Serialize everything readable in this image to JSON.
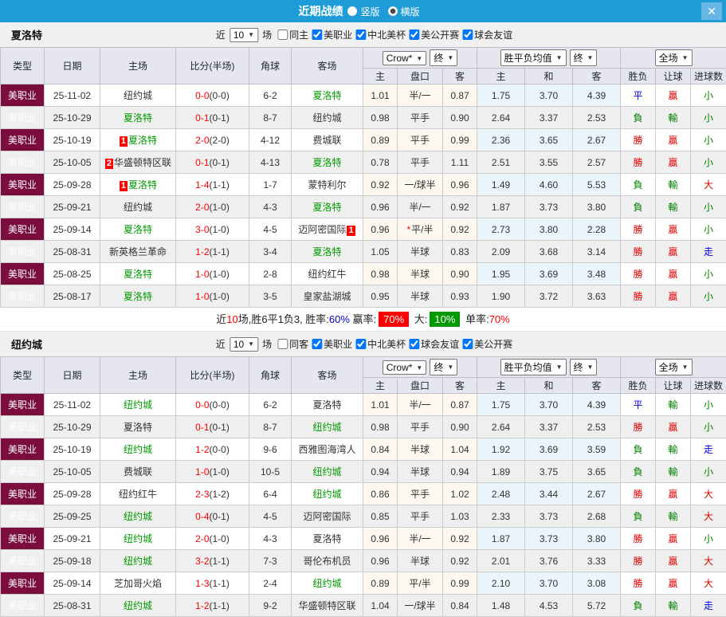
{
  "header": {
    "title": "近期战绩",
    "layout_options": [
      {
        "label": "竖版",
        "selected": false
      },
      {
        "label": "横版",
        "selected": true
      }
    ],
    "close_icon": "✕"
  },
  "columns": {
    "type": "类型",
    "date": "日期",
    "home": "主场",
    "score": "比分(半场)",
    "corner": "角球",
    "away": "客场",
    "odds_select": "Crow*",
    "odds_final": "终",
    "odds_sub": [
      "主",
      "盘口",
      "客"
    ],
    "euro_select": "胜平负均值",
    "euro_final": "终",
    "euro_sub": [
      "主",
      "和",
      "客"
    ],
    "scope_select": "全场",
    "result_sub": [
      "胜负",
      "让球",
      "进球数"
    ]
  },
  "colors": {
    "accent_blue": "#1e9cd8",
    "type_maroon": "#7b0c3e",
    "team_green": "#009000",
    "score_red": "#ff0000",
    "win_red": "#e00000",
    "lose_green": "#008000",
    "draw_blue": "#0000e0"
  },
  "tables": [
    {
      "team": "夏洛特",
      "filter": {
        "near": "近",
        "count": "10",
        "games": "场",
        "same": "同主",
        "same_checked": false,
        "leagues": [
          {
            "label": "美职业",
            "checked": true
          },
          {
            "label": "中北美杯",
            "checked": true
          },
          {
            "label": "美公开赛",
            "checked": true
          },
          {
            "label": "球会友谊",
            "checked": true
          }
        ]
      },
      "rows": [
        {
          "type": "美职业",
          "date": "25-11-02",
          "home": "纽约城",
          "home_badge": "",
          "home_green": false,
          "ft": "0-0",
          "half": "(0-0)",
          "corner": "6-2",
          "away": "夏洛特",
          "away_badge": "",
          "away_green": true,
          "ah": [
            "1.01",
            "半/一",
            "0.87"
          ],
          "ah_star": false,
          "eu": [
            "1.75",
            "3.70",
            "4.39"
          ],
          "res": [
            "平",
            "贏",
            "小"
          ]
        },
        {
          "type": "美职业",
          "date": "25-10-29",
          "home": "夏洛特",
          "home_badge": "",
          "home_green": true,
          "ft": "0-1",
          "half": "(0-1)",
          "corner": "8-7",
          "away": "纽约城",
          "away_badge": "",
          "away_green": false,
          "ah": [
            "0.98",
            "平手",
            "0.90"
          ],
          "ah_star": false,
          "eu": [
            "2.64",
            "3.37",
            "2.53"
          ],
          "res": [
            "負",
            "輸",
            "小"
          ]
        },
        {
          "type": "美职业",
          "date": "25-10-19",
          "home": "夏洛特",
          "home_badge": "1",
          "home_green": true,
          "ft": "2-0",
          "half": "(2-0)",
          "corner": "4-12",
          "away": "费城联",
          "away_badge": "",
          "away_green": false,
          "ah": [
            "0.89",
            "平手",
            "0.99"
          ],
          "ah_star": false,
          "eu": [
            "2.36",
            "3.65",
            "2.67"
          ],
          "res": [
            "勝",
            "贏",
            "小"
          ]
        },
        {
          "type": "美职业",
          "date": "25-10-05",
          "home": "华盛顿特区联",
          "home_badge": "2",
          "home_green": false,
          "ft": "0-1",
          "half": "(0-1)",
          "corner": "4-13",
          "away": "夏洛特",
          "away_badge": "",
          "away_green": true,
          "ah": [
            "0.78",
            "平手",
            "1.11"
          ],
          "ah_star": false,
          "eu": [
            "2.51",
            "3.55",
            "2.57"
          ],
          "res": [
            "勝",
            "贏",
            "小"
          ]
        },
        {
          "type": "美职业",
          "date": "25-09-28",
          "home": "夏洛特",
          "home_badge": "1",
          "home_green": true,
          "ft": "1-4",
          "half": "(1-1)",
          "corner": "1-7",
          "away": "蒙特利尔",
          "away_badge": "",
          "away_green": false,
          "ah": [
            "0.92",
            "一/球半",
            "0.96"
          ],
          "ah_star": false,
          "eu": [
            "1.49",
            "4.60",
            "5.53"
          ],
          "res": [
            "負",
            "輸",
            "大"
          ]
        },
        {
          "type": "美职业",
          "date": "25-09-21",
          "home": "纽约城",
          "home_badge": "",
          "home_green": false,
          "ft": "2-0",
          "half": "(1-0)",
          "corner": "4-3",
          "away": "夏洛特",
          "away_badge": "",
          "away_green": true,
          "ah": [
            "0.96",
            "半/一",
            "0.92"
          ],
          "ah_star": false,
          "eu": [
            "1.87",
            "3.73",
            "3.80"
          ],
          "res": [
            "負",
            "輸",
            "小"
          ]
        },
        {
          "type": "美职业",
          "date": "25-09-14",
          "home": "夏洛特",
          "home_badge": "",
          "home_green": true,
          "ft": "3-0",
          "half": "(1-0)",
          "corner": "4-5",
          "away": "迈阿密国际",
          "away_badge": "1",
          "away_green": false,
          "ah": [
            "0.96",
            "平/半",
            "0.92"
          ],
          "ah_star": true,
          "eu": [
            "2.73",
            "3.80",
            "2.28"
          ],
          "res": [
            "勝",
            "贏",
            "小"
          ]
        },
        {
          "type": "美职业",
          "date": "25-08-31",
          "home": "新英格兰革命",
          "home_badge": "",
          "home_green": false,
          "ft": "1-2",
          "half": "(1-1)",
          "corner": "3-4",
          "away": "夏洛特",
          "away_badge": "",
          "away_green": true,
          "ah": [
            "1.05",
            "半球",
            "0.83"
          ],
          "ah_star": false,
          "eu": [
            "2.09",
            "3.68",
            "3.14"
          ],
          "res": [
            "勝",
            "贏",
            "走"
          ]
        },
        {
          "type": "美职业",
          "date": "25-08-25",
          "home": "夏洛特",
          "home_badge": "",
          "home_green": true,
          "ft": "1-0",
          "half": "(1-0)",
          "corner": "2-8",
          "away": "纽约红牛",
          "away_badge": "",
          "away_green": false,
          "ah": [
            "0.98",
            "半球",
            "0.90"
          ],
          "ah_star": false,
          "eu": [
            "1.95",
            "3.69",
            "3.48"
          ],
          "res": [
            "勝",
            "贏",
            "小"
          ]
        },
        {
          "type": "美职业",
          "date": "25-08-17",
          "home": "夏洛特",
          "home_badge": "",
          "home_green": true,
          "ft": "1-0",
          "half": "(1-0)",
          "corner": "3-5",
          "away": "皇家盐湖城",
          "away_badge": "",
          "away_green": false,
          "ah": [
            "0.95",
            "半球",
            "0.93"
          ],
          "ah_star": false,
          "eu": [
            "1.90",
            "3.72",
            "3.63"
          ],
          "res": [
            "勝",
            "贏",
            "小"
          ]
        }
      ],
      "summary": [
        {
          "text": "近"
        },
        {
          "text": "10",
          "style": "red"
        },
        {
          "text": "场,胜6平1负3, 胜率:"
        },
        {
          "text": "60%",
          "style": "blue"
        },
        {
          "text": " 赢率:"
        },
        {
          "text": "70%",
          "style": "bg-red"
        },
        {
          "text": " 大:"
        },
        {
          "text": "10%",
          "style": "bg-green"
        },
        {
          "text": " 单率:"
        },
        {
          "text": "70%",
          "style": "red"
        }
      ]
    },
    {
      "team": "纽约城",
      "filter": {
        "near": "近",
        "count": "10",
        "games": "场",
        "same": "同客",
        "same_checked": false,
        "leagues": [
          {
            "label": "美职业",
            "checked": true
          },
          {
            "label": "中北美杯",
            "checked": true
          },
          {
            "label": "球会友谊",
            "checked": true
          },
          {
            "label": "美公开赛",
            "checked": true
          }
        ]
      },
      "rows": [
        {
          "type": "美职业",
          "date": "25-11-02",
          "home": "纽约城",
          "home_badge": "",
          "home_green": true,
          "ft": "0-0",
          "half": "(0-0)",
          "corner": "6-2",
          "away": "夏洛特",
          "away_badge": "",
          "away_green": false,
          "ah": [
            "1.01",
            "半/一",
            "0.87"
          ],
          "ah_star": false,
          "eu": [
            "1.75",
            "3.70",
            "4.39"
          ],
          "res": [
            "平",
            "輸",
            "小"
          ]
        },
        {
          "type": "美职业",
          "date": "25-10-29",
          "home": "夏洛特",
          "home_badge": "",
          "home_green": false,
          "ft": "0-1",
          "half": "(0-1)",
          "corner": "8-7",
          "away": "纽约城",
          "away_badge": "",
          "away_green": true,
          "ah": [
            "0.98",
            "平手",
            "0.90"
          ],
          "ah_star": false,
          "eu": [
            "2.64",
            "3.37",
            "2.53"
          ],
          "res": [
            "勝",
            "贏",
            "小"
          ]
        },
        {
          "type": "美职业",
          "date": "25-10-19",
          "home": "纽约城",
          "home_badge": "",
          "home_green": true,
          "ft": "1-2",
          "half": "(0-0)",
          "corner": "9-6",
          "away": "西雅图海湾人",
          "away_badge": "",
          "away_green": false,
          "ah": [
            "0.84",
            "半球",
            "1.04"
          ],
          "ah_star": false,
          "eu": [
            "1.92",
            "3.69",
            "3.59"
          ],
          "res": [
            "負",
            "輸",
            "走"
          ]
        },
        {
          "type": "美职业",
          "date": "25-10-05",
          "home": "费城联",
          "home_badge": "",
          "home_green": false,
          "ft": "1-0",
          "half": "(1-0)",
          "corner": "10-5",
          "away": "纽约城",
          "away_badge": "",
          "away_green": true,
          "ah": [
            "0.94",
            "半球",
            "0.94"
          ],
          "ah_star": false,
          "eu": [
            "1.89",
            "3.75",
            "3.65"
          ],
          "res": [
            "負",
            "輸",
            "小"
          ]
        },
        {
          "type": "美职业",
          "date": "25-09-28",
          "home": "纽约红牛",
          "home_badge": "",
          "home_green": false,
          "ft": "2-3",
          "half": "(1-2)",
          "corner": "6-4",
          "away": "纽约城",
          "away_badge": "",
          "away_green": true,
          "ah": [
            "0.86",
            "平手",
            "1.02"
          ],
          "ah_star": false,
          "eu": [
            "2.48",
            "3.44",
            "2.67"
          ],
          "res": [
            "勝",
            "贏",
            "大"
          ]
        },
        {
          "type": "美职业",
          "date": "25-09-25",
          "home": "纽约城",
          "home_badge": "",
          "home_green": true,
          "ft": "0-4",
          "half": "(0-1)",
          "corner": "4-5",
          "away": "迈阿密国际",
          "away_badge": "",
          "away_green": false,
          "ah": [
            "0.85",
            "平手",
            "1.03"
          ],
          "ah_star": false,
          "eu": [
            "2.33",
            "3.73",
            "2.68"
          ],
          "res": [
            "負",
            "輸",
            "大"
          ]
        },
        {
          "type": "美职业",
          "date": "25-09-21",
          "home": "纽约城",
          "home_badge": "",
          "home_green": true,
          "ft": "2-0",
          "half": "(1-0)",
          "corner": "4-3",
          "away": "夏洛特",
          "away_badge": "",
          "away_green": false,
          "ah": [
            "0.96",
            "半/一",
            "0.92"
          ],
          "ah_star": false,
          "eu": [
            "1.87",
            "3.73",
            "3.80"
          ],
          "res": [
            "勝",
            "贏",
            "小"
          ]
        },
        {
          "type": "美职业",
          "date": "25-09-18",
          "home": "纽约城",
          "home_badge": "",
          "home_green": true,
          "ft": "3-2",
          "half": "(1-1)",
          "corner": "7-3",
          "away": "哥伦布机员",
          "away_badge": "",
          "away_green": false,
          "ah": [
            "0.96",
            "半球",
            "0.92"
          ],
          "ah_star": false,
          "eu": [
            "2.01",
            "3.76",
            "3.33"
          ],
          "res": [
            "勝",
            "贏",
            "大"
          ]
        },
        {
          "type": "美职业",
          "date": "25-09-14",
          "home": "芝加哥火焰",
          "home_badge": "",
          "home_green": false,
          "ft": "1-3",
          "half": "(1-1)",
          "corner": "2-4",
          "away": "纽约城",
          "away_badge": "",
          "away_green": true,
          "ah": [
            "0.89",
            "平/半",
            "0.99"
          ],
          "ah_star": false,
          "eu": [
            "2.10",
            "3.70",
            "3.08"
          ],
          "res": [
            "勝",
            "贏",
            "大"
          ]
        },
        {
          "type": "美职业",
          "date": "25-08-31",
          "home": "纽约城",
          "home_badge": "",
          "home_green": true,
          "ft": "1-2",
          "half": "(1-1)",
          "corner": "9-2",
          "away": "华盛顿特区联",
          "away_badge": "",
          "away_green": false,
          "ah": [
            "1.04",
            "一/球半",
            "0.84"
          ],
          "ah_star": false,
          "eu": [
            "1.48",
            "4.53",
            "5.72"
          ],
          "res": [
            "負",
            "輸",
            "走"
          ]
        }
      ]
    }
  ]
}
